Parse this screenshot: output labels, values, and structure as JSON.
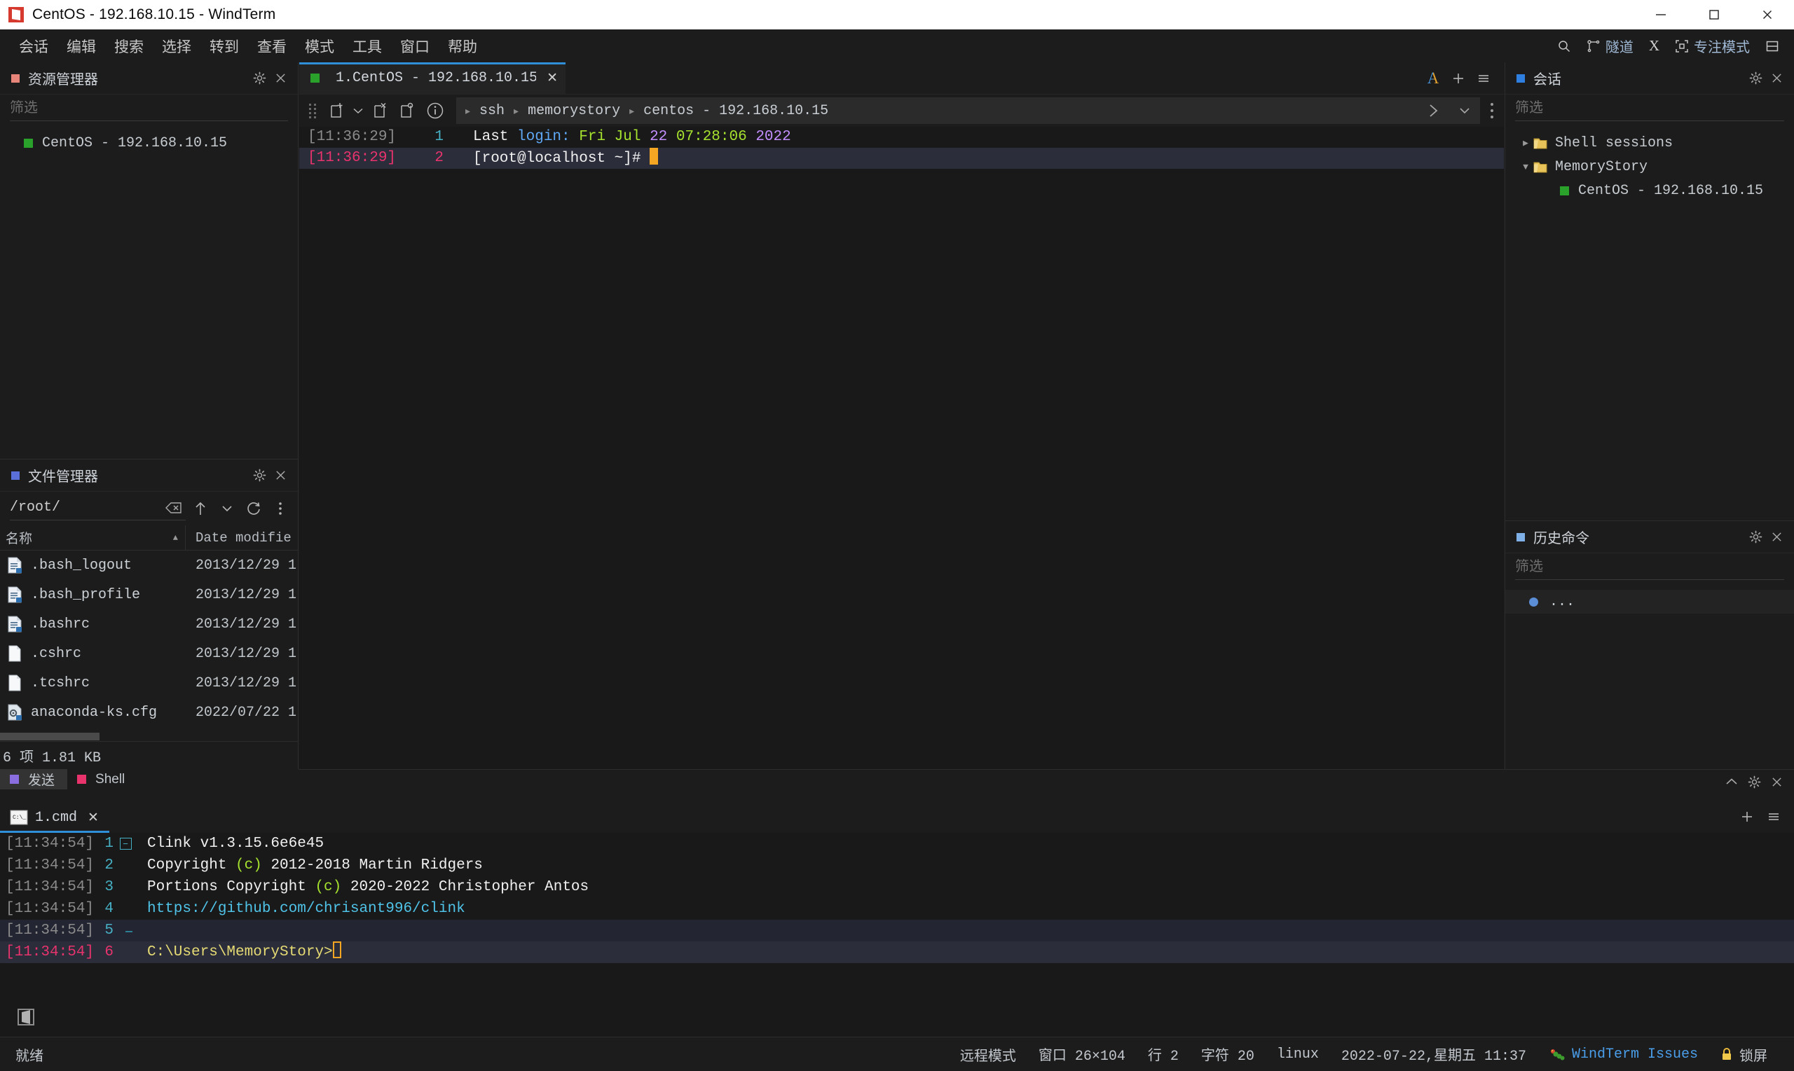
{
  "window": {
    "title": "CentOS - 192.168.10.15 - WindTerm",
    "minimize_label": "minimize",
    "maximize_label": "maximize",
    "close_label": "close"
  },
  "menubar": {
    "items": [
      {
        "label": "会话"
      },
      {
        "label": "编辑"
      },
      {
        "label": "搜索"
      },
      {
        "label": "选择"
      },
      {
        "label": "转到"
      },
      {
        "label": "查看"
      },
      {
        "label": "模式"
      },
      {
        "label": "工具"
      },
      {
        "label": "窗口"
      },
      {
        "label": "帮助"
      }
    ],
    "right_tools": [
      {
        "icon": "search-icon",
        "label": ""
      },
      {
        "icon": "tunnel-icon",
        "label": "隧道"
      },
      {
        "icon": "x-icon",
        "label": "X"
      },
      {
        "icon": "focus-mode-icon",
        "label": "专注模式"
      },
      {
        "icon": "layout-icon",
        "label": ""
      }
    ]
  },
  "explorer": {
    "title": "资源管理器",
    "dot_color": "#e8857a",
    "filter_placeholder": "筛选",
    "filter_value": "",
    "items": [
      {
        "label": "CentOS - 192.168.10.15",
        "dot_color": "#2aa12a"
      }
    ]
  },
  "filemanager": {
    "title": "文件管理器",
    "dot_color": "#5b6fd8",
    "path": "/root/",
    "clear_label": "clear",
    "columns": [
      "名称",
      "Date modifie"
    ],
    "rows": [
      {
        "name": ".bash_logout",
        "date": "2013/12/29 1",
        "icon": "script-file-icon"
      },
      {
        "name": ".bash_profile",
        "date": "2013/12/29 1",
        "icon": "script-file-icon"
      },
      {
        "name": ".bashrc",
        "date": "2013/12/29 1",
        "icon": "script-file-icon"
      },
      {
        "name": ".cshrc",
        "date": "2013/12/29 1",
        "icon": "plain-file-icon"
      },
      {
        "name": ".tcshrc",
        "date": "2013/12/29 1",
        "icon": "plain-file-icon"
      },
      {
        "name": "anaconda-ks.cfg",
        "date": "2022/07/22 1",
        "icon": "config-file-icon"
      }
    ],
    "status": "6 项 1.81 KB"
  },
  "left_tabs": [
    {
      "label": "发送",
      "dot_color": "#8a6ee0",
      "active": true
    },
    {
      "label": "Shell",
      "dot_color": "#e8336d",
      "active": false
    }
  ],
  "terminal_tabs": [
    {
      "label": "1.CentOS - 192.168.10.15",
      "dot_color": "#2aa12a",
      "active": true,
      "close_label": "✕"
    }
  ],
  "terminal_toolbar": {
    "font_icon_label": "A",
    "add_label": "+",
    "menu_label": "≡"
  },
  "breadcrumb": {
    "info_label": "i",
    "crumbs": [
      "ssh",
      "memorystory",
      "centos - 192.168.10.15"
    ],
    "separator": "▸",
    "run_label": "❯",
    "dropdown_label": "⌄"
  },
  "terminal": {
    "lines": [
      {
        "time": "[11:36:29]",
        "num": "1",
        "current": false,
        "segments": [
          {
            "text": "Last ",
            "color": "white"
          },
          {
            "text": "login:",
            "color": "blue"
          },
          {
            "text": " Fri Jul ",
            "color": "green"
          },
          {
            "text": "22",
            "color": "purple"
          },
          {
            "text": " 07:28:06 ",
            "color": "green"
          },
          {
            "text": "2022",
            "color": "purple"
          }
        ]
      },
      {
        "time": "[11:36:29]",
        "num": "2",
        "current": true,
        "segments": [
          {
            "text": "[root@localhost ~]# ",
            "color": "white"
          }
        ],
        "cursor": "block"
      }
    ]
  },
  "shell_panel": {
    "tabs": [
      {
        "label": "1.cmd",
        "icon": "cmd-icon",
        "active": true,
        "close_label": "✕"
      }
    ],
    "collapse_label": "⌃",
    "settings_label": "gear",
    "close_label": "✕",
    "add_label": "+",
    "menu_label": "≡",
    "lines": [
      {
        "time": "[11:34:54]",
        "num": "1",
        "fold": "start",
        "current": false,
        "segments": [
          {
            "text": "Clink v1.3.15.6e6e45",
            "color": "white"
          }
        ]
      },
      {
        "time": "[11:34:54]",
        "num": "2",
        "fold": "mid",
        "current": false,
        "segments": [
          {
            "text": "Copyright ",
            "color": "white"
          },
          {
            "text": "(c)",
            "color": "green"
          },
          {
            "text": " 2012-2018 Martin Ridgers",
            "color": "white"
          }
        ]
      },
      {
        "time": "[11:34:54]",
        "num": "3",
        "fold": "mid",
        "current": false,
        "segments": [
          {
            "text": "Portions Copyright ",
            "color": "white"
          },
          {
            "text": "(c)",
            "color": "green"
          },
          {
            "text": " 2020-2022 Christopher Antos",
            "color": "white"
          }
        ]
      },
      {
        "time": "[11:34:54]",
        "num": "4",
        "fold": "mid",
        "current": false,
        "segments": [
          {
            "text": "https://github.com/chrisant996/clink",
            "color": "cyan"
          }
        ]
      },
      {
        "time": "[11:34:54]",
        "num": "5",
        "fold": "end",
        "current": false,
        "highlight": true,
        "segments": [
          {
            "text": "",
            "color": "white"
          }
        ]
      },
      {
        "time": "[11:34:54]",
        "num": "6",
        "fold": "none",
        "current": true,
        "segments": [
          {
            "text": "C:\\Users\\MemoryStory",
            "color": "yellow"
          },
          {
            "text": ">",
            "color": "yellow"
          }
        ],
        "cursor": "hollow"
      }
    ]
  },
  "sessions": {
    "title": "会话",
    "dot_color": "#2f7fe0",
    "filter_placeholder": "筛选",
    "filter_value": "",
    "tree": [
      {
        "label": "Shell sessions",
        "type": "folder",
        "expanded": false,
        "twisty": "▶",
        "depth": 0
      },
      {
        "label": "MemoryStory",
        "type": "folder",
        "expanded": true,
        "twisty": "▼",
        "depth": 0
      },
      {
        "label": "CentOS - 192.168.10.15",
        "type": "session",
        "dot_color": "#2aa12a",
        "depth": 1
      }
    ]
  },
  "history": {
    "title": "历史命令",
    "dot_color": "#7fb1e8",
    "filter_placeholder": "筛选",
    "filter_value": "",
    "items": [
      {
        "label": "...",
        "dot_color": "#5b8ed6"
      }
    ]
  },
  "statusbar": {
    "ready": "就绪",
    "items": [
      {
        "name": "mode",
        "label": "远程模式"
      },
      {
        "name": "window-size",
        "label": "窗口 26×104"
      },
      {
        "name": "line",
        "label": "行 2"
      },
      {
        "name": "chars",
        "label": "字符 20"
      },
      {
        "name": "terminal-type",
        "label": "linux"
      },
      {
        "name": "datetime",
        "label": "2022-07-22,星期五 11:37"
      },
      {
        "name": "issues",
        "label": "WindTerm Issues",
        "color": "#4a9eea",
        "icon": "bug-icon"
      },
      {
        "name": "lock",
        "label": "锁屏",
        "icon": "lock-icon"
      }
    ]
  }
}
